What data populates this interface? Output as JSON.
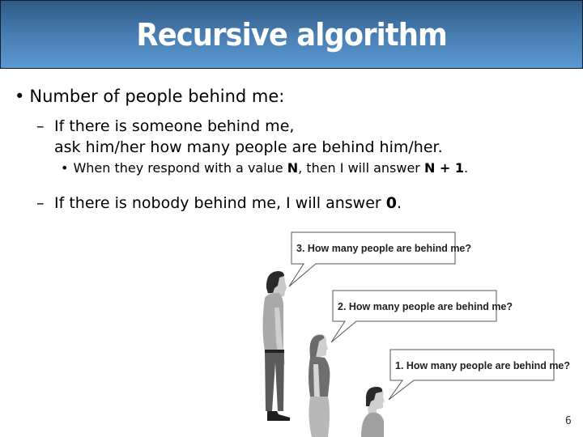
{
  "slide": {
    "title": "Recursive algorithm",
    "page_number": "6",
    "bullets": {
      "level1": "Number of people behind me:",
      "level2a_line1": "If there is someone behind me,",
      "level2a_line2": "ask him/her how many people are behind him/her.",
      "level3_pre": "When they respond with a value ",
      "level3_N": "N",
      "level3_mid": ", then I will answer ",
      "level3_answer": "N + 1",
      "level3_end": ".",
      "level2b_pre": "If there is nobody behind me, I will answer ",
      "level2b_value": "0",
      "level2b_end": "."
    },
    "bullet_glyph": "•",
    "dash_glyph": "–"
  },
  "illustration": {
    "bubbles": [
      {
        "text": "3. How many people are behind me?"
      },
      {
        "text": "2. How many people are behind me?"
      },
      {
        "text": "1. How many people are behind me?"
      }
    ]
  }
}
